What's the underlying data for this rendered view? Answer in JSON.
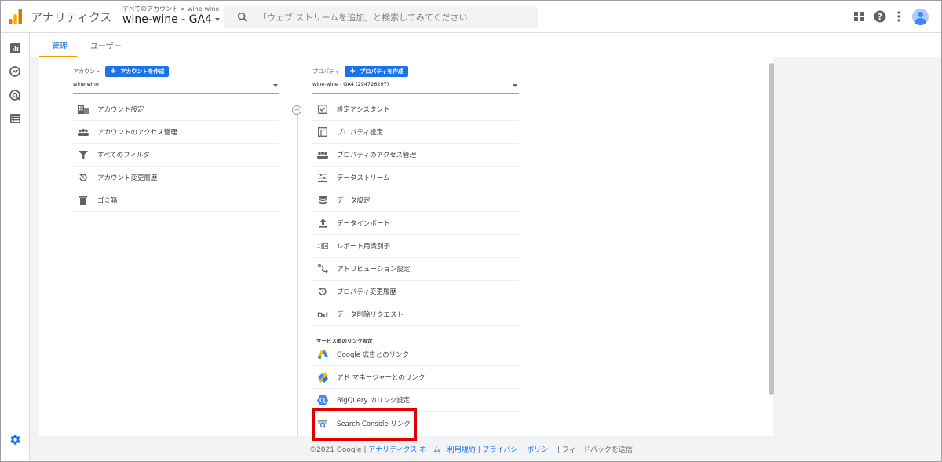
{
  "header": {
    "app_title": "アナリティクス",
    "breadcrumb": "すべてのアカウント > wine-wine",
    "property_title": "wine-wine - GA4",
    "search_placeholder": "「ウェブ ストリームを追加」と検索してみてください",
    "icons": [
      "apps-grid-icon",
      "help-icon",
      "more-vert-icon",
      "account-avatar-icon"
    ]
  },
  "rail": {
    "icons": [
      "reports-icon",
      "explore-icon",
      "advertising-icon",
      "configure-icon",
      "settings-gear-icon"
    ]
  },
  "tabs": [
    {
      "label": "管理",
      "active": true
    },
    {
      "label": "ユーザー",
      "active": false
    }
  ],
  "account": {
    "heading": "アカウント",
    "create_label": "アカウントを作成",
    "selected": "wine-wine",
    "items": [
      {
        "label": "アカウント設定",
        "icon": "building-icon"
      },
      {
        "label": "アカウントのアクセス管理",
        "icon": "people-icon"
      },
      {
        "label": "すべてのフィルタ",
        "icon": "filter-icon"
      },
      {
        "label": "アカウント変更履歴",
        "icon": "history-icon"
      },
      {
        "label": "ゴミ箱",
        "icon": "trash-icon"
      }
    ]
  },
  "property": {
    "heading": "プロパティ",
    "create_label": "プロパティを作成",
    "selected": "wine-wine - GA4 (294726297)",
    "items": [
      {
        "label": "設定アシスタント",
        "icon": "checklist-icon"
      },
      {
        "label": "プロパティ設定",
        "icon": "property-settings-icon"
      },
      {
        "label": "プロパティのアクセス管理",
        "icon": "people-icon"
      },
      {
        "label": "データストリーム",
        "icon": "data-streams-icon"
      },
      {
        "label": "データ設定",
        "icon": "database-icon"
      },
      {
        "label": "データインポート",
        "icon": "upload-icon"
      },
      {
        "label": "レポート用識別子",
        "icon": "reporting-identity-icon"
      },
      {
        "label": "アトリビューション設定",
        "icon": "attribution-icon"
      },
      {
        "label": "プロパティ変更履歴",
        "icon": "history-icon"
      },
      {
        "label": "データ削除リクエスト",
        "icon": "dd-icon"
      }
    ],
    "links_section_label": "サービス間のリンク設定",
    "links": [
      {
        "label": "Google 広告とのリンク",
        "icon": "google-ads-icon"
      },
      {
        "label": "アド マネージャーとのリンク",
        "icon": "ad-manager-icon"
      },
      {
        "label": "BigQuery のリンク設定",
        "icon": "bigquery-icon"
      },
      {
        "label": "Search Console リンク",
        "icon": "search-console-icon"
      }
    ]
  },
  "footer": {
    "copyright": "©2021 Google",
    "sep": "|",
    "links": [
      "アナリティクス ホーム",
      "利用規約",
      "プライバシー ポリシー"
    ],
    "feedback": "フィードバックを送信"
  },
  "colors": {
    "accent_blue": "#1a73e8",
    "tab_underline": "#f29900",
    "highlight_red": "#e00000",
    "background_gray": "#f1f3f4"
  }
}
